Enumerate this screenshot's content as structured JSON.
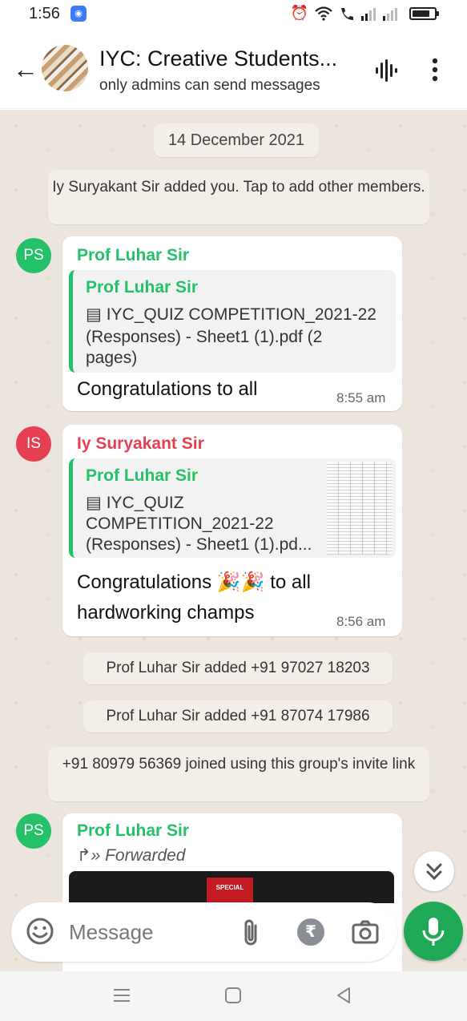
{
  "status_bar": {
    "time": "1:56",
    "battery_level": 0.8
  },
  "header": {
    "title": "IYC: Creative Students...",
    "subtitle": "only admins can send messages"
  },
  "chat": {
    "date_chip": "14 December 2021",
    "system_messages": [
      "Iy Suryakant Sir added you. Tap to add other members.",
      "Prof Luhar Sir added +91 97027 18203",
      "Prof Luhar Sir added +91 87074 17986",
      "+91 80979 56369 joined using this group's invite link"
    ],
    "messages": [
      {
        "initials": "PS",
        "sender": "Prof Luhar Sir",
        "sender_color": "#25c16a",
        "avatar_color": "#25c16a",
        "quote_name": "Prof Luhar Sir",
        "quote_text_line1": "IYC_QUIZ COMPETITION_2021-22",
        "quote_text_line2": "(Responses) - Sheet1 (1).pdf (2",
        "quote_text_line3": "pages)",
        "text": "Congratulations to all",
        "time": "8:55 am"
      },
      {
        "initials": "IS",
        "sender": "Iy Suryakant Sir",
        "sender_color": "#e53f52",
        "avatar_color": "#e53f52",
        "quote_name": "Prof Luhar Sir",
        "quote_text_line1": "IYC_QUIZ",
        "quote_text_line2": "COMPETITION_2021-22",
        "quote_text_line3": "(Responses) - Sheet1 (1).pd...",
        "text_part1": "Congratulations",
        "emoji1": "🎉",
        "emoji2": "🎉",
        "text_part2": "to all",
        "text_line2": "hardworking champs",
        "time": "8:56 am"
      },
      {
        "initials": "PS",
        "sender": "Prof Luhar Sir",
        "sender_color": "#25c16a",
        "avatar_color": "#25c16a",
        "forwarded_label": "Forwarded",
        "image_badge": "SPECIAL"
      }
    ]
  },
  "input": {
    "placeholder": "Message",
    "rupee_symbol": "₹"
  },
  "colors": {
    "accent": "#1fa855",
    "chat_bg": "#ece5dd"
  }
}
